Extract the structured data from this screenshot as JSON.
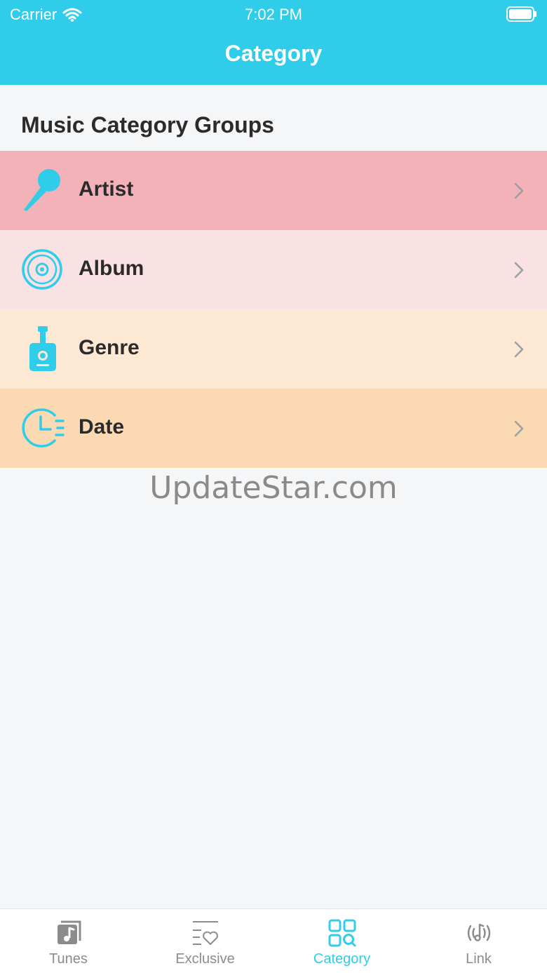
{
  "status_bar": {
    "carrier": "Carrier",
    "time": "7:02 PM"
  },
  "nav": {
    "title": "Category"
  },
  "section": {
    "title": "Music Category Groups"
  },
  "groups": [
    {
      "label": "Artist",
      "icon": "microphone-icon",
      "color": "#f2b2b7"
    },
    {
      "label": "Album",
      "icon": "vinyl-disc-icon",
      "color": "#fae1e4"
    },
    {
      "label": "Genre",
      "icon": "guitar-icon",
      "color": "#fde8d4"
    },
    {
      "label": "Date",
      "icon": "clock-list-icon",
      "color": "#fbd9b3"
    }
  ],
  "watermark": "UpdateStar.com",
  "tabs": [
    {
      "label": "Tunes",
      "icon": "music-note-icon",
      "active": false
    },
    {
      "label": "Exclusive",
      "icon": "list-heart-icon",
      "active": false
    },
    {
      "label": "Category",
      "icon": "grid-search-icon",
      "active": true
    },
    {
      "label": "Link",
      "icon": "broadcast-note-icon",
      "active": false
    }
  ],
  "colors": {
    "accent": "#2fcdea",
    "inactive": "#8c8c8c"
  }
}
